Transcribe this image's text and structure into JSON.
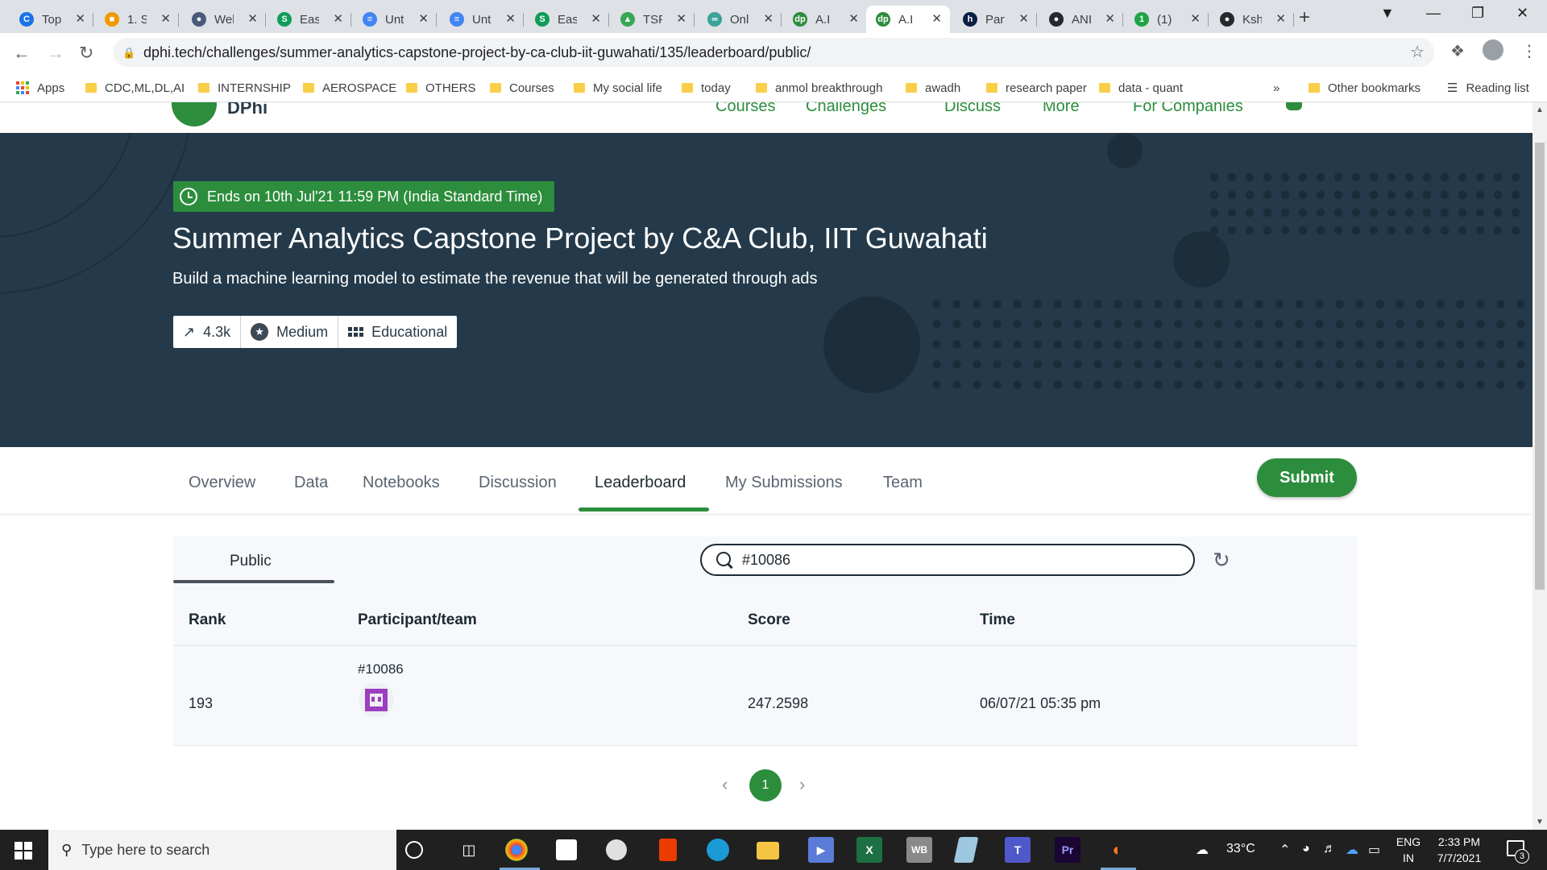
{
  "browser": {
    "tabs": [
      {
        "title": "Top",
        "color": "#1a73e8",
        "glyph": "C"
      },
      {
        "title": "1. S",
        "color": "#f29900",
        "glyph": "■"
      },
      {
        "title": "Wel",
        "color": "#4a5a7a",
        "glyph": "●"
      },
      {
        "title": "Easy",
        "color": "#0f9d58",
        "glyph": "S"
      },
      {
        "title": "Unt",
        "color": "#4285f4",
        "glyph": "≡"
      },
      {
        "title": "Unt",
        "color": "#4285f4",
        "glyph": "≡"
      },
      {
        "title": "Easy",
        "color": "#0f9d58",
        "glyph": "S"
      },
      {
        "title": "TSF",
        "color": "#34a853",
        "glyph": "▲"
      },
      {
        "title": "Onl",
        "color": "#3aa39a",
        "glyph": "∞"
      },
      {
        "title": "A.I",
        "color": "#2c8d3c",
        "glyph": "dp"
      },
      {
        "title": "A.I",
        "color": "#2c8d3c",
        "glyph": "dp"
      },
      {
        "title": "Part",
        "color": "#0a1f44",
        "glyph": "h"
      },
      {
        "title": "ANI",
        "color": "#24292e",
        "glyph": "●"
      },
      {
        "title": "(1)",
        "color": "#1ea446",
        "glyph": "1"
      },
      {
        "title": "Ksh",
        "color": "#24292e",
        "glyph": "●"
      }
    ],
    "active_tab_index": 10,
    "url": "dphi.tech/challenges/summer-analytics-capstone-project-by-ca-club-iit-guwahati/135/leaderboard/public/",
    "bookmarks": [
      {
        "label": "Apps"
      },
      {
        "label": "CDC,ML,DL,AI"
      },
      {
        "label": "INTERNSHIP"
      },
      {
        "label": "AEROSPACE"
      },
      {
        "label": "OTHERS"
      },
      {
        "label": "Courses"
      },
      {
        "label": "My social life"
      },
      {
        "label": "today"
      },
      {
        "label": "anmol breakthrough"
      },
      {
        "label": "awadh"
      },
      {
        "label": "research paper"
      },
      {
        "label": "data - quant"
      }
    ],
    "overflow": "»",
    "other_bookmarks": "Other bookmarks",
    "reading_list": "Reading list"
  },
  "site": {
    "logo_text": "DPhi",
    "nav": [
      "Courses",
      "Challenges",
      "Discuss",
      "More",
      "For Companies"
    ]
  },
  "challenge": {
    "deadline": "Ends on 10th Jul'21 11:59 PM (India Standard Time)",
    "title": "Summer Analytics Capstone Project by C&A Club, IIT Guwahati",
    "subtitle": "Build a machine learning model to estimate the revenue that will be generated through ads",
    "stats": {
      "participants": "4.3k",
      "difficulty": "Medium",
      "type": "Educational"
    }
  },
  "tabs": [
    "Overview",
    "Data",
    "Notebooks",
    "Discussion",
    "Leaderboard",
    "My Submissions",
    "Team"
  ],
  "active_tab": "Leaderboard",
  "submit_label": "Submit",
  "leaderboard": {
    "tab": "Public",
    "search_value": "#10086",
    "columns": [
      "Rank",
      "Participant/team",
      "Score",
      "Time"
    ],
    "rows": [
      {
        "rank": "193",
        "team": "#10086",
        "score": "247.2598",
        "time": "06/07/21 05:35 pm"
      }
    ],
    "current_page": "1"
  },
  "taskbar": {
    "search_placeholder": "Type here to search",
    "temperature": "33°C",
    "lang": "ENG",
    "region": "IN",
    "time": "2:33 PM",
    "date": "7/7/2021",
    "notifications": "3"
  }
}
